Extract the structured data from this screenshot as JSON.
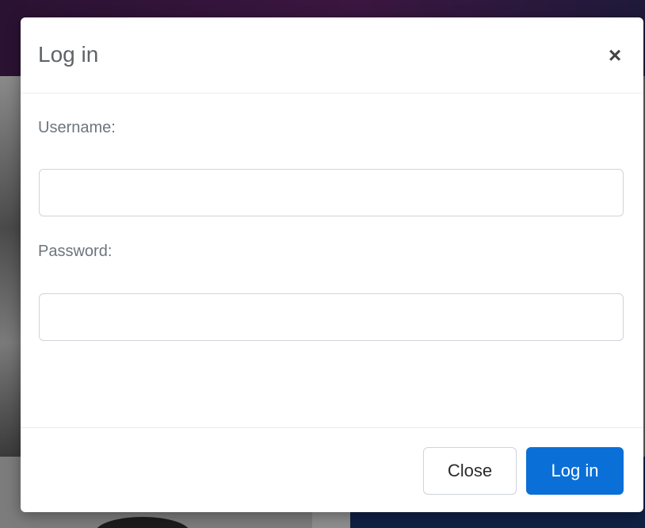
{
  "modal": {
    "title": "Log in",
    "close_icon_glyph": "×",
    "username": {
      "label": "Username:",
      "value": ""
    },
    "password": {
      "label": "Password:",
      "value": ""
    },
    "footer": {
      "close_label": "Close",
      "login_label": "Log in"
    }
  },
  "colors": {
    "primary": "#0b6fd8",
    "title_text": "#5f6368",
    "label_text": "#6c757d",
    "border": "#cfd4d9"
  },
  "icons": {
    "close": "close-icon"
  }
}
